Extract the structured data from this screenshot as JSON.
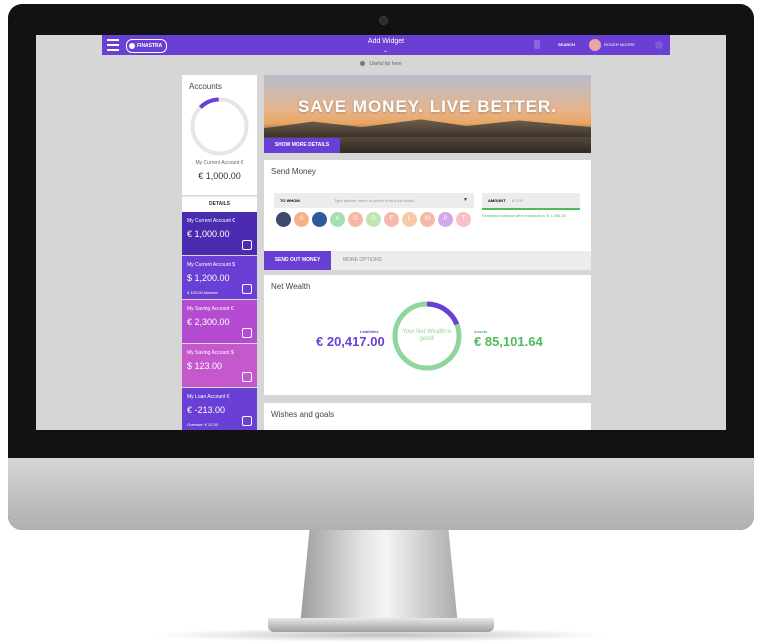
{
  "topbar": {
    "logo": "FINASTRA",
    "title": "Add Widget",
    "search": "SEARCH",
    "user": "ROGER MOORE"
  },
  "tip": "Useful tip here",
  "accounts_panel": {
    "title": "Accounts",
    "current_label": "My Current Account €",
    "current_value": "€ 1,000.00",
    "details_label": "DETAILS",
    "gauge_fraction": 0.12,
    "cards": [
      {
        "name": "My Current Account €",
        "amount": "€ 1,000.00",
        "note": "",
        "color": "#4b2cb0"
      },
      {
        "name": "My Current Account $",
        "amount": "$ 1,200.00",
        "note": "$ 100.00 blocked",
        "color": "#6a3fd3"
      },
      {
        "name": "My Saving Account €",
        "amount": "€ 2,300.00",
        "note": "",
        "color": "#b54bd0"
      },
      {
        "name": "My Saving Account $",
        "amount": "$ 123.00",
        "note": "",
        "color": "#c458cc"
      },
      {
        "name": "My Loan Account €",
        "amount": "€ -213.00",
        "note": "Overdue: € 32.00",
        "color": "#6a3fd3"
      }
    ]
  },
  "hero": {
    "text": "SAVE MONEY. LIVE BETTER.",
    "button": "SHOW MORE DETAILS"
  },
  "send_money": {
    "title": "Send Money",
    "to_label": "TO WHOM",
    "to_placeholder": "Type partner name or select from a list below...",
    "amount_label": "AMOUNT",
    "amount_value": "€ 0.00",
    "estimated": "Estimated balance after transaction: € 1,000.00",
    "contacts": [
      {
        "letter": "",
        "color": "#3a4a6a"
      },
      {
        "letter": "A",
        "color": "#f6b08a"
      },
      {
        "letter": "",
        "color": "#2f5a9a"
      },
      {
        "letter": "A",
        "color": "#a6dfb0"
      },
      {
        "letter": "D",
        "color": "#f6b8a0"
      },
      {
        "letter": "D",
        "color": "#bfe6b0"
      },
      {
        "letter": "F",
        "color": "#f8b8b0"
      },
      {
        "letter": "L",
        "color": "#f8c8a8"
      },
      {
        "letter": "M",
        "color": "#f6b8a8"
      },
      {
        "letter": "P",
        "color": "#d2a8e8"
      },
      {
        "letter": "T",
        "color": "#f6c0c8"
      }
    ],
    "send_button": "SEND OUT MONEY",
    "more_button": "MORE OPTIONS"
  },
  "net_wealth": {
    "title": "Net Wealth",
    "liabilities_label": "Liabilities",
    "liabilities_value": "€ 20,417.00",
    "assets_label": "Assets",
    "assets_value": "€ 85,101.64",
    "status": "Your Net Wealth is good!",
    "liabilities_fraction": 0.19
  },
  "wishes": {
    "title": "Wishes and goals"
  }
}
